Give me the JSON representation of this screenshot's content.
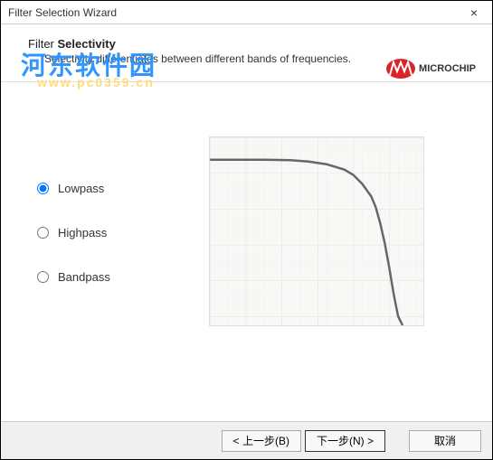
{
  "window": {
    "title": "Filter Selection Wizard",
    "close_symbol": "×"
  },
  "header": {
    "title_prefix": "Filter ",
    "title_bold": "Selectivity",
    "description": "Selectivity differentiates between different bands of frequencies.",
    "brand": "MICROCHIP"
  },
  "watermark": {
    "text": "河东软件园",
    "url": "www.pc0359.cn"
  },
  "options": {
    "lowpass": "Lowpass",
    "highpass": "Highpass",
    "bandpass": "Bandpass",
    "selected": "lowpass"
  },
  "buttons": {
    "back": "< 上一步(B)",
    "next": "下一步(N) >",
    "cancel": "取消"
  },
  "chart_data": {
    "type": "line",
    "title": "",
    "xlabel": "",
    "ylabel": "",
    "x": [
      0,
      60,
      90,
      110,
      130,
      150,
      160,
      170,
      180,
      185,
      190,
      195,
      200,
      205,
      210,
      215
    ],
    "y": [
      25,
      25,
      25.5,
      27,
      30,
      36,
      42,
      52,
      66,
      78,
      96,
      118,
      145,
      175,
      200,
      210
    ],
    "xlim": [
      0,
      238
    ],
    "ylim": [
      0,
      210
    ],
    "description": "Lowpass filter response curve: flat passband then steep rolloff"
  }
}
